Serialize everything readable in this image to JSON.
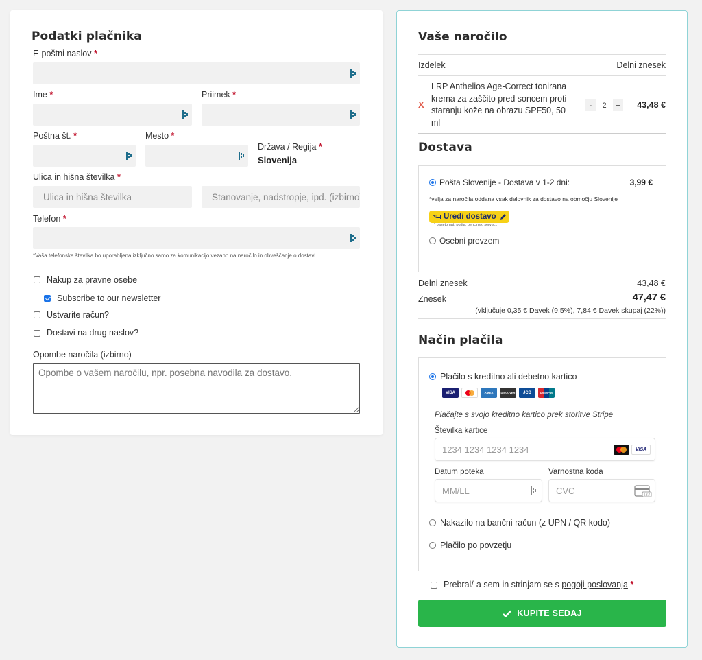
{
  "billing": {
    "title": "Podatki plačnika",
    "required_mark": "*",
    "email_label": "E-poštni naslov",
    "first_name_label": "Ime",
    "last_name_label": "Priimek",
    "postcode_label": "Poštna št.",
    "city_label": "Mesto",
    "country_label": "Država / Regija",
    "country_value": "Slovenija",
    "street_label": "Ulica in hišna številka",
    "street_placeholder": "Ulica in hišna številka",
    "street2_placeholder": "Stanovanje, nadstropje, ipd. (izbirno)",
    "phone_label": "Telefon",
    "phone_hint": "*Vaša telefonska številka bo uporabljena izključno samo za komunikacijo vezano na naročilo in obveščanje o dostavi.",
    "checkboxes": {
      "company": "Nakup za pravne osebe",
      "newsletter": "Subscribe to our newsletter",
      "create_account": "Ustvarite račun?",
      "ship_different": "Dostavi na drug naslov?"
    },
    "notes_label": "Opombe naročila (izbirno)",
    "notes_placeholder": "Opombe o vašem naročilu, npr. posebna navodila za dostavo."
  },
  "order": {
    "title": "Vaše naročilo",
    "col_product": "Izdelek",
    "col_subtotal": "Delni znesek",
    "product_name": "LRP Anthelios Age-Correct tonirana krema za zaščito pred soncem proti staranju kože na obrazu SPF50, 50 ml",
    "product_name_lines": [
      "LRP Anthelios Age-Correct tonirana",
      "krema za zaščito pred soncem proti",
      "staranju kože na obrazu SPF50, 50",
      "ml"
    ],
    "remove_symbol": "X",
    "qty_minus": "-",
    "qty": "2",
    "qty_plus": "+",
    "line_total": "43,48 €"
  },
  "shipping": {
    "title": "Dostava",
    "option1_label": "Pošta Slovenije - Dostava v 1-2 dni:",
    "option1_price": "3,99 €",
    "option1_note": "*velja za naročila oddana vsak delovnik za dostavo na območju Slovenije",
    "edit_button": "Uredi dostavo",
    "edit_sub": "paketomat, pošta, bencinski servis...",
    "option2_label": "Osebni prevzem"
  },
  "totals": {
    "subtotal_label": "Delni znesek",
    "subtotal_value": "43,48 €",
    "total_label": "Znesek",
    "total_value": "47,47 €",
    "tax_note": "(vključuje 0,35 € Davek (9.5%), 7,84 € Davek skupaj (22%))"
  },
  "payment": {
    "title": "Način plačila",
    "card_option_label": "Plačilo s kreditno ali debetno kartico",
    "card_brands": [
      "VISA",
      "MC",
      "AMEX",
      "DISCOVER",
      "JCB",
      "UnionPay"
    ],
    "stripe_desc": "Plačajte s svojo kreditno kartico prek storitve Stripe",
    "card_number_label": "Številka kartice",
    "card_number_placeholder": "1234 1234 1234 1234",
    "expiry_label": "Datum poteka",
    "expiry_placeholder": "MM/LL",
    "cvc_label": "Varnostna koda",
    "cvc_placeholder": "CVC",
    "bank_option_label": "Nakazilo na bančni račun (z UPN / QR kodo)",
    "cod_option_label": "Plačilo po povzetju"
  },
  "terms": {
    "text": "Prebral/-a sem in strinjam se s",
    "link": "pogoji poslovanja"
  },
  "submit": {
    "label": "KUPITE SEDAJ"
  },
  "colors": {
    "accent_blue": "#1a73e8",
    "required_red": "#c0102a",
    "remove_red": "#e05a4a",
    "buy_green": "#29b54a",
    "card_border_teal": "#8fd3d6",
    "posta_yellow": "#f7d117"
  }
}
